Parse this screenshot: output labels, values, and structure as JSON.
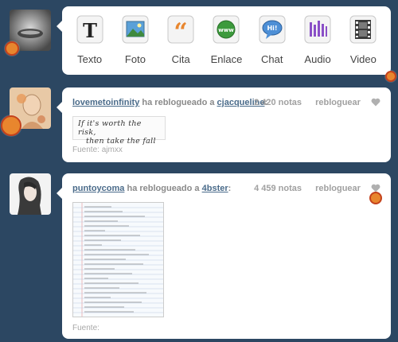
{
  "composer": {
    "types": [
      {
        "label": "Texto",
        "icon": "text-icon"
      },
      {
        "label": "Foto",
        "icon": "photo-icon"
      },
      {
        "label": "Cita",
        "icon": "quote-icon"
      },
      {
        "label": "Enlace",
        "icon": "link-icon"
      },
      {
        "label": "Chat",
        "icon": "chat-icon"
      },
      {
        "label": "Audio",
        "icon": "audio-icon"
      },
      {
        "label": "Video",
        "icon": "video-icon"
      }
    ]
  },
  "posts": [
    {
      "user": "lovemetoinfinity",
      "verb": "ha reblogueado a",
      "from": "cjacqueline",
      "notes": "2 420 notas",
      "reblog": "rebloguear",
      "quote": [
        "If it's worth the risk,",
        "then take the fall"
      ],
      "source_label": "Fuente:",
      "source": "ajmxx"
    },
    {
      "user": "puntoycoma",
      "verb": "ha reblogueado a",
      "from": "4bster",
      "notes": "4 459 notas",
      "reblog": "rebloguear",
      "source_label": "Fuente:",
      "source": ""
    }
  ],
  "colors": {
    "background": "#2c4762",
    "link": "#4a6b8a",
    "indicator": "#e8862e"
  }
}
